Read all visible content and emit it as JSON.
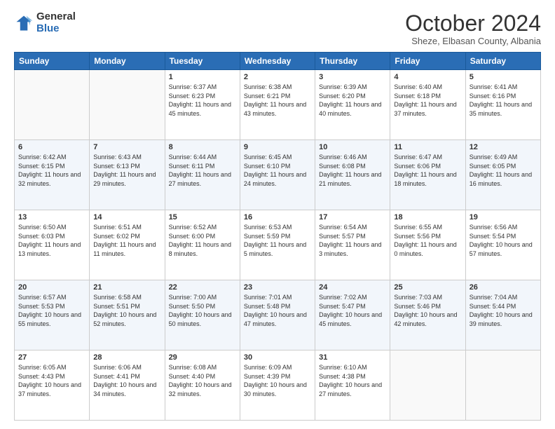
{
  "header": {
    "logo_general": "General",
    "logo_blue": "Blue",
    "title": "October 2024",
    "subtitle": "Sheze, Elbasan County, Albania"
  },
  "days_of_week": [
    "Sunday",
    "Monday",
    "Tuesday",
    "Wednesday",
    "Thursday",
    "Friday",
    "Saturday"
  ],
  "weeks": [
    [
      {
        "day": "",
        "info": ""
      },
      {
        "day": "",
        "info": ""
      },
      {
        "day": "1",
        "info": "Sunrise: 6:37 AM\nSunset: 6:23 PM\nDaylight: 11 hours and 45 minutes."
      },
      {
        "day": "2",
        "info": "Sunrise: 6:38 AM\nSunset: 6:21 PM\nDaylight: 11 hours and 43 minutes."
      },
      {
        "day": "3",
        "info": "Sunrise: 6:39 AM\nSunset: 6:20 PM\nDaylight: 11 hours and 40 minutes."
      },
      {
        "day": "4",
        "info": "Sunrise: 6:40 AM\nSunset: 6:18 PM\nDaylight: 11 hours and 37 minutes."
      },
      {
        "day": "5",
        "info": "Sunrise: 6:41 AM\nSunset: 6:16 PM\nDaylight: 11 hours and 35 minutes."
      }
    ],
    [
      {
        "day": "6",
        "info": "Sunrise: 6:42 AM\nSunset: 6:15 PM\nDaylight: 11 hours and 32 minutes."
      },
      {
        "day": "7",
        "info": "Sunrise: 6:43 AM\nSunset: 6:13 PM\nDaylight: 11 hours and 29 minutes."
      },
      {
        "day": "8",
        "info": "Sunrise: 6:44 AM\nSunset: 6:11 PM\nDaylight: 11 hours and 27 minutes."
      },
      {
        "day": "9",
        "info": "Sunrise: 6:45 AM\nSunset: 6:10 PM\nDaylight: 11 hours and 24 minutes."
      },
      {
        "day": "10",
        "info": "Sunrise: 6:46 AM\nSunset: 6:08 PM\nDaylight: 11 hours and 21 minutes."
      },
      {
        "day": "11",
        "info": "Sunrise: 6:47 AM\nSunset: 6:06 PM\nDaylight: 11 hours and 18 minutes."
      },
      {
        "day": "12",
        "info": "Sunrise: 6:49 AM\nSunset: 6:05 PM\nDaylight: 11 hours and 16 minutes."
      }
    ],
    [
      {
        "day": "13",
        "info": "Sunrise: 6:50 AM\nSunset: 6:03 PM\nDaylight: 11 hours and 13 minutes."
      },
      {
        "day": "14",
        "info": "Sunrise: 6:51 AM\nSunset: 6:02 PM\nDaylight: 11 hours and 11 minutes."
      },
      {
        "day": "15",
        "info": "Sunrise: 6:52 AM\nSunset: 6:00 PM\nDaylight: 11 hours and 8 minutes."
      },
      {
        "day": "16",
        "info": "Sunrise: 6:53 AM\nSunset: 5:59 PM\nDaylight: 11 hours and 5 minutes."
      },
      {
        "day": "17",
        "info": "Sunrise: 6:54 AM\nSunset: 5:57 PM\nDaylight: 11 hours and 3 minutes."
      },
      {
        "day": "18",
        "info": "Sunrise: 6:55 AM\nSunset: 5:56 PM\nDaylight: 11 hours and 0 minutes."
      },
      {
        "day": "19",
        "info": "Sunrise: 6:56 AM\nSunset: 5:54 PM\nDaylight: 10 hours and 57 minutes."
      }
    ],
    [
      {
        "day": "20",
        "info": "Sunrise: 6:57 AM\nSunset: 5:53 PM\nDaylight: 10 hours and 55 minutes."
      },
      {
        "day": "21",
        "info": "Sunrise: 6:58 AM\nSunset: 5:51 PM\nDaylight: 10 hours and 52 minutes."
      },
      {
        "day": "22",
        "info": "Sunrise: 7:00 AM\nSunset: 5:50 PM\nDaylight: 10 hours and 50 minutes."
      },
      {
        "day": "23",
        "info": "Sunrise: 7:01 AM\nSunset: 5:48 PM\nDaylight: 10 hours and 47 minutes."
      },
      {
        "day": "24",
        "info": "Sunrise: 7:02 AM\nSunset: 5:47 PM\nDaylight: 10 hours and 45 minutes."
      },
      {
        "day": "25",
        "info": "Sunrise: 7:03 AM\nSunset: 5:46 PM\nDaylight: 10 hours and 42 minutes."
      },
      {
        "day": "26",
        "info": "Sunrise: 7:04 AM\nSunset: 5:44 PM\nDaylight: 10 hours and 39 minutes."
      }
    ],
    [
      {
        "day": "27",
        "info": "Sunrise: 6:05 AM\nSunset: 4:43 PM\nDaylight: 10 hours and 37 minutes."
      },
      {
        "day": "28",
        "info": "Sunrise: 6:06 AM\nSunset: 4:41 PM\nDaylight: 10 hours and 34 minutes."
      },
      {
        "day": "29",
        "info": "Sunrise: 6:08 AM\nSunset: 4:40 PM\nDaylight: 10 hours and 32 minutes."
      },
      {
        "day": "30",
        "info": "Sunrise: 6:09 AM\nSunset: 4:39 PM\nDaylight: 10 hours and 30 minutes."
      },
      {
        "day": "31",
        "info": "Sunrise: 6:10 AM\nSunset: 4:38 PM\nDaylight: 10 hours and 27 minutes."
      },
      {
        "day": "",
        "info": ""
      },
      {
        "day": "",
        "info": ""
      }
    ]
  ]
}
